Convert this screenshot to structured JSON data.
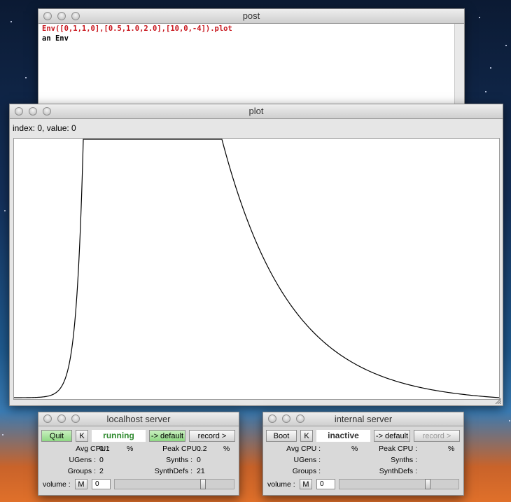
{
  "post_window": {
    "title": "post",
    "lines": [
      "Env([0,1,1,0],[0.5,1.0,2.0],[10,0,-4]).plot",
      "an Env"
    ]
  },
  "plot_window": {
    "title": "plot",
    "index_label": "index: 0, value: 0"
  },
  "chart_data": {
    "type": "line",
    "levels": [
      0,
      1,
      1,
      0
    ],
    "times": [
      0.5,
      1.0,
      2.0
    ],
    "curves": [
      10,
      0,
      -4
    ],
    "xlim": [
      0,
      3.5
    ],
    "ylim": [
      0,
      1
    ]
  },
  "servers": [
    {
      "title": "localhost server",
      "boot_label": "Quit",
      "kill_label": "K",
      "status": "running",
      "default_label": "-> default",
      "record_label": "record >",
      "avg_cpu_label": "Avg CPU :",
      "avg_cpu": "0.1",
      "peak_cpu_label": "Peak CPU :",
      "peak_cpu": "0.2",
      "pct": "%",
      "ugens_label": "UGens :",
      "ugens": "0",
      "synths_label": "Synths :",
      "synths": "0",
      "groups_label": "Groups :",
      "groups": "2",
      "synthdefs_label": "SynthDefs :",
      "synthdefs": "21",
      "volume_label": "volume :",
      "mute_label": "M",
      "volume_value": "0",
      "volume_level": 0.75,
      "status_color": "#2f8a2f"
    },
    {
      "title": "internal server",
      "boot_label": "Boot",
      "kill_label": "K",
      "status": "inactive",
      "default_label": "-> default",
      "record_label": "record >",
      "avg_cpu_label": "Avg CPU :",
      "avg_cpu": "",
      "peak_cpu_label": "Peak CPU :",
      "peak_cpu": "",
      "pct": "%",
      "ugens_label": "UGens :",
      "ugens": "",
      "synths_label": "Synths :",
      "synths": "",
      "groups_label": "Groups :",
      "groups": "",
      "synthdefs_label": "SynthDefs :",
      "synthdefs": "",
      "volume_label": "volume :",
      "mute_label": "M",
      "volume_value": "0",
      "volume_level": 0.75,
      "status_color": "#333333"
    }
  ],
  "icons": [
    "close-icon",
    "minimize-icon",
    "zoom-icon",
    "resize-grip-icon"
  ]
}
